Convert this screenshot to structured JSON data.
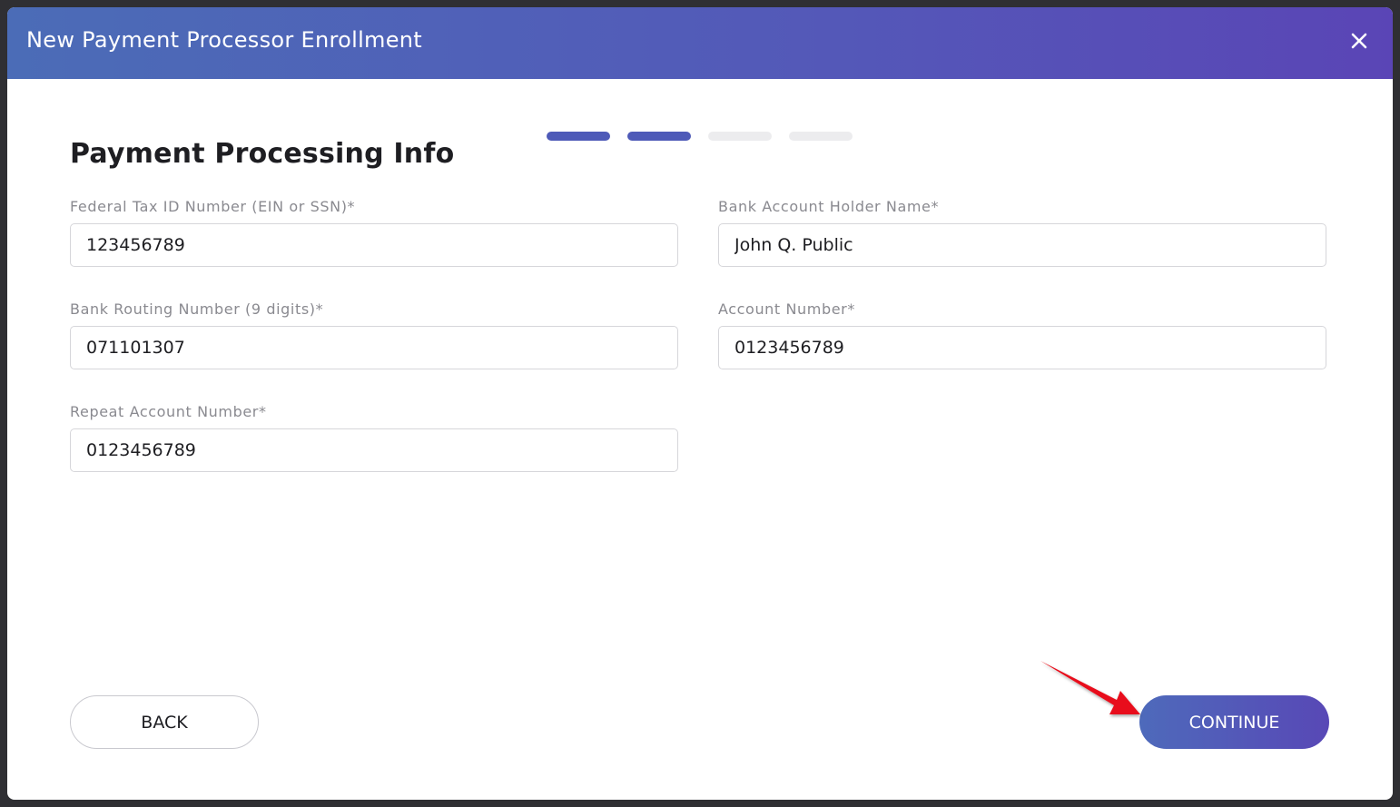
{
  "header": {
    "title": "New Payment Processor Enrollment",
    "close_icon": "close-icon"
  },
  "stepper": {
    "total_steps": 4,
    "completed_steps": 2,
    "active_color": "#4e5ab8",
    "inactive_color": "#ececee"
  },
  "form": {
    "title": "Payment Processing Info",
    "fields": {
      "federal_tax_id": {
        "label": "Federal Tax ID Number (EIN or SSN)*",
        "value": "123456789"
      },
      "account_holder_name": {
        "label": "Bank Account Holder Name*",
        "value": "John Q. Public"
      },
      "routing_number": {
        "label": "Bank Routing Number (9 digits)*",
        "value": "071101307"
      },
      "account_number": {
        "label": "Account Number*",
        "value": "0123456789"
      },
      "repeat_account_number": {
        "label": "Repeat Account Number*",
        "value": "0123456789"
      }
    }
  },
  "actions": {
    "back_label": "BACK",
    "continue_label": "CONTINUE"
  },
  "annotation": {
    "arrow_icon": "red-arrow-icon",
    "color": "#e8101a"
  },
  "colors": {
    "header_gradient_start": "#4b6cb7",
    "header_gradient_end": "#5a45b6",
    "accent": "#5458b8"
  }
}
